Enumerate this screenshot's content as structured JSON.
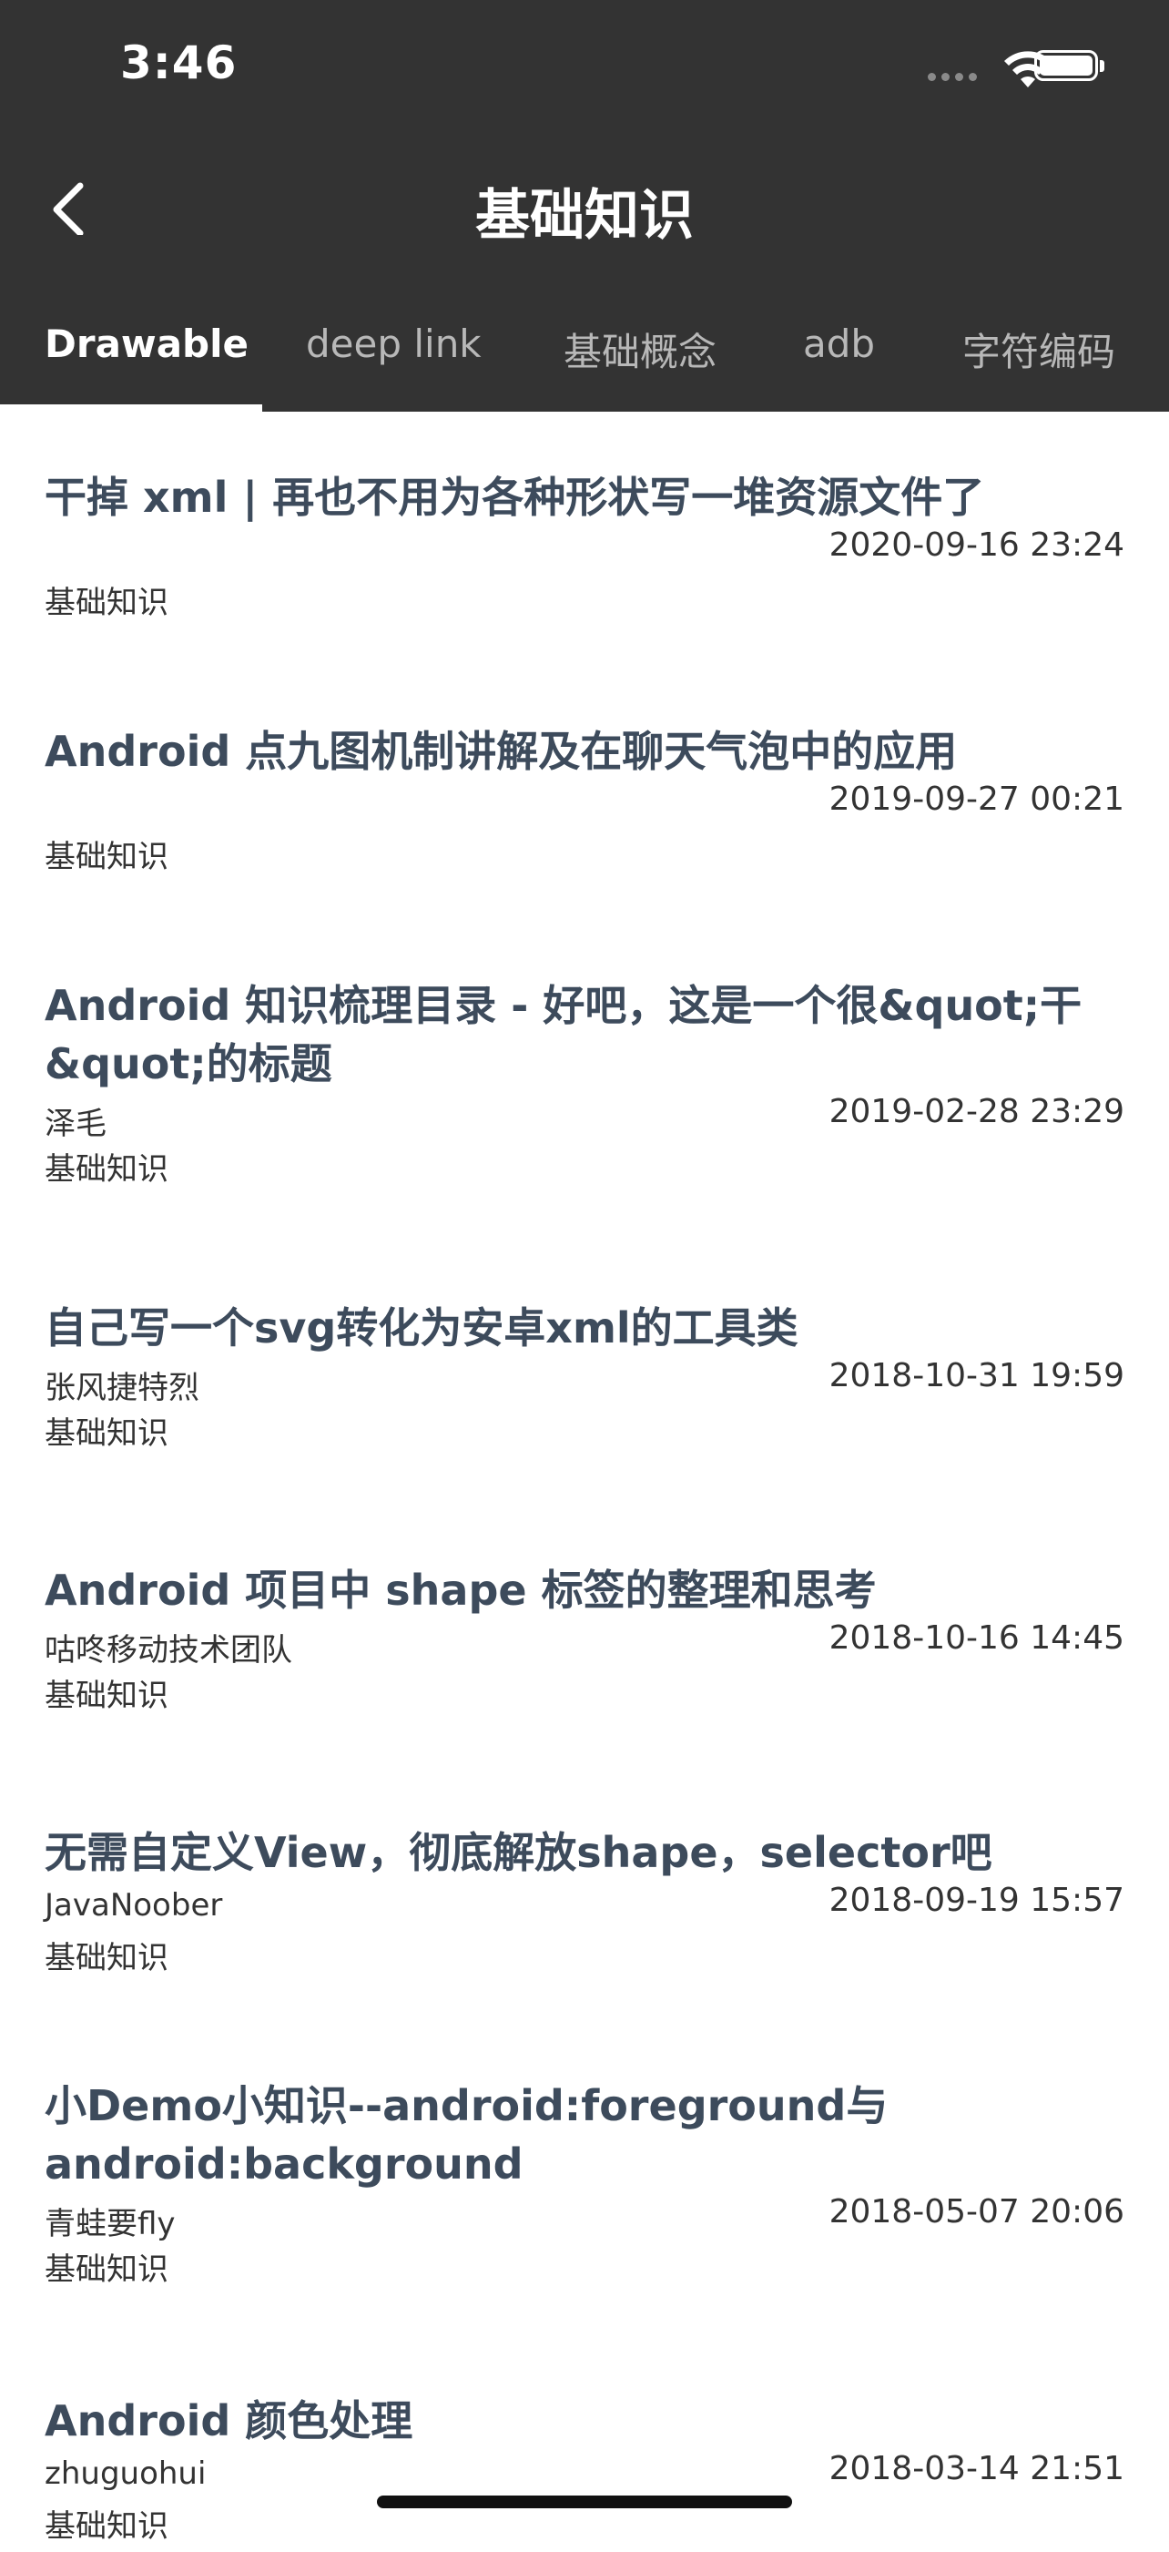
{
  "status_bar": {
    "time": "3:46"
  },
  "nav": {
    "title": "基础知识"
  },
  "tabs": [
    {
      "label": "Drawable"
    },
    {
      "label": "deep link"
    },
    {
      "label": "基础概念"
    },
    {
      "label": "adb"
    },
    {
      "label": "字符编码"
    }
  ],
  "articles": [
    {
      "title": "干掉 xml | 再也不用为各种形状写一堆资源文件了",
      "author": "",
      "date": "2020-09-16 23:24",
      "category": "基础知识"
    },
    {
      "title": "Android 点九图机制讲解及在聊天气泡中的应用",
      "author": "",
      "date": "2019-09-27 00:21",
      "category": "基础知识"
    },
    {
      "title": "Android 知识梳理目录 - 好吧，这是一个很&quot;干&quot;的标题",
      "author": "泽毛",
      "date": "2019-02-28 23:29",
      "category": "基础知识"
    },
    {
      "title": "自己写一个svg转化为安卓xml的工具类",
      "author": "张风捷特烈",
      "date": "2018-10-31 19:59",
      "category": "基础知识"
    },
    {
      "title": "Android 项目中 shape 标签的整理和思考",
      "author": "咕咚移动技术团队",
      "date": "2018-10-16 14:45",
      "category": "基础知识"
    },
    {
      "title": "无需自定义View，彻底解放shape，selector吧",
      "author": "JavaNoober",
      "date": "2018-09-19 15:57",
      "category": "基础知识"
    },
    {
      "title": "小Demo小知识--android:foreground与android:background",
      "author": "青蛙要fly",
      "date": "2018-05-07 20:06",
      "category": "基础知识"
    },
    {
      "title": "Android 颜色处理",
      "author": "zhuguohui",
      "date": "2018-03-14 21:51",
      "category": "基础知识"
    }
  ]
}
